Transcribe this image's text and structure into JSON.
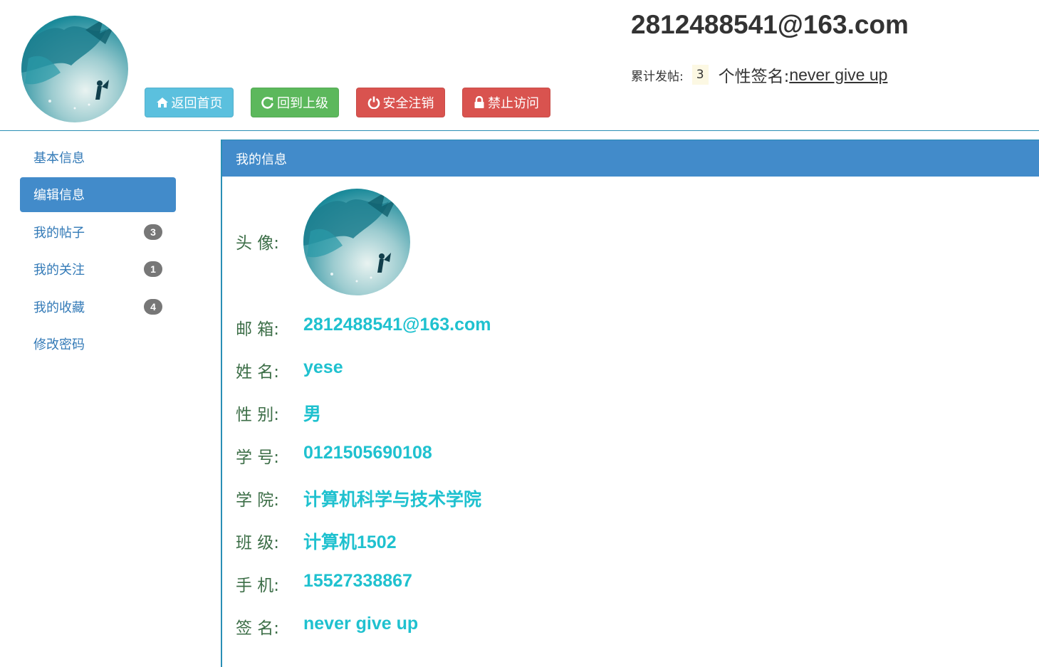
{
  "header": {
    "email": "2812488541@163.com",
    "post_count_label": "累计发帖:",
    "post_count": "3",
    "signature_label": "个性签名:",
    "signature": "never give up",
    "buttons": {
      "home": "返回首页",
      "up": "回到上级",
      "logout": "安全注销",
      "ban": "禁止访问"
    }
  },
  "sidebar": {
    "items": [
      {
        "label": "基本信息"
      },
      {
        "label": "编辑信息",
        "active": true
      },
      {
        "label": "我的帖子",
        "badge": "3"
      },
      {
        "label": "我的关注",
        "badge": "1"
      },
      {
        "label": "我的收藏",
        "badge": "4"
      },
      {
        "label": "修改密码"
      }
    ]
  },
  "panel": {
    "title": "我的信息",
    "fields": [
      {
        "label": "头 像:"
      },
      {
        "label": "邮 箱:",
        "value": "2812488541@163.com"
      },
      {
        "label": "姓 名:",
        "value": "yese"
      },
      {
        "label": "性 别:",
        "value": "男"
      },
      {
        "label": "学 号:",
        "value": "0121505690108"
      },
      {
        "label": "学 院:",
        "value": "计算机科学与技术学院"
      },
      {
        "label": "班 级:",
        "value": "计算机1502"
      },
      {
        "label": "手 机:",
        "value": "15527338867"
      },
      {
        "label": "签 名:",
        "value": "never give up"
      }
    ]
  },
  "colors": {
    "accent_blue": "#428bca",
    "value_cyan": "#1fc1cf",
    "label_green": "#3c6e47",
    "btn_info": "#5bc0de",
    "btn_success": "#5cb85c",
    "btn_danger": "#d9534f"
  }
}
